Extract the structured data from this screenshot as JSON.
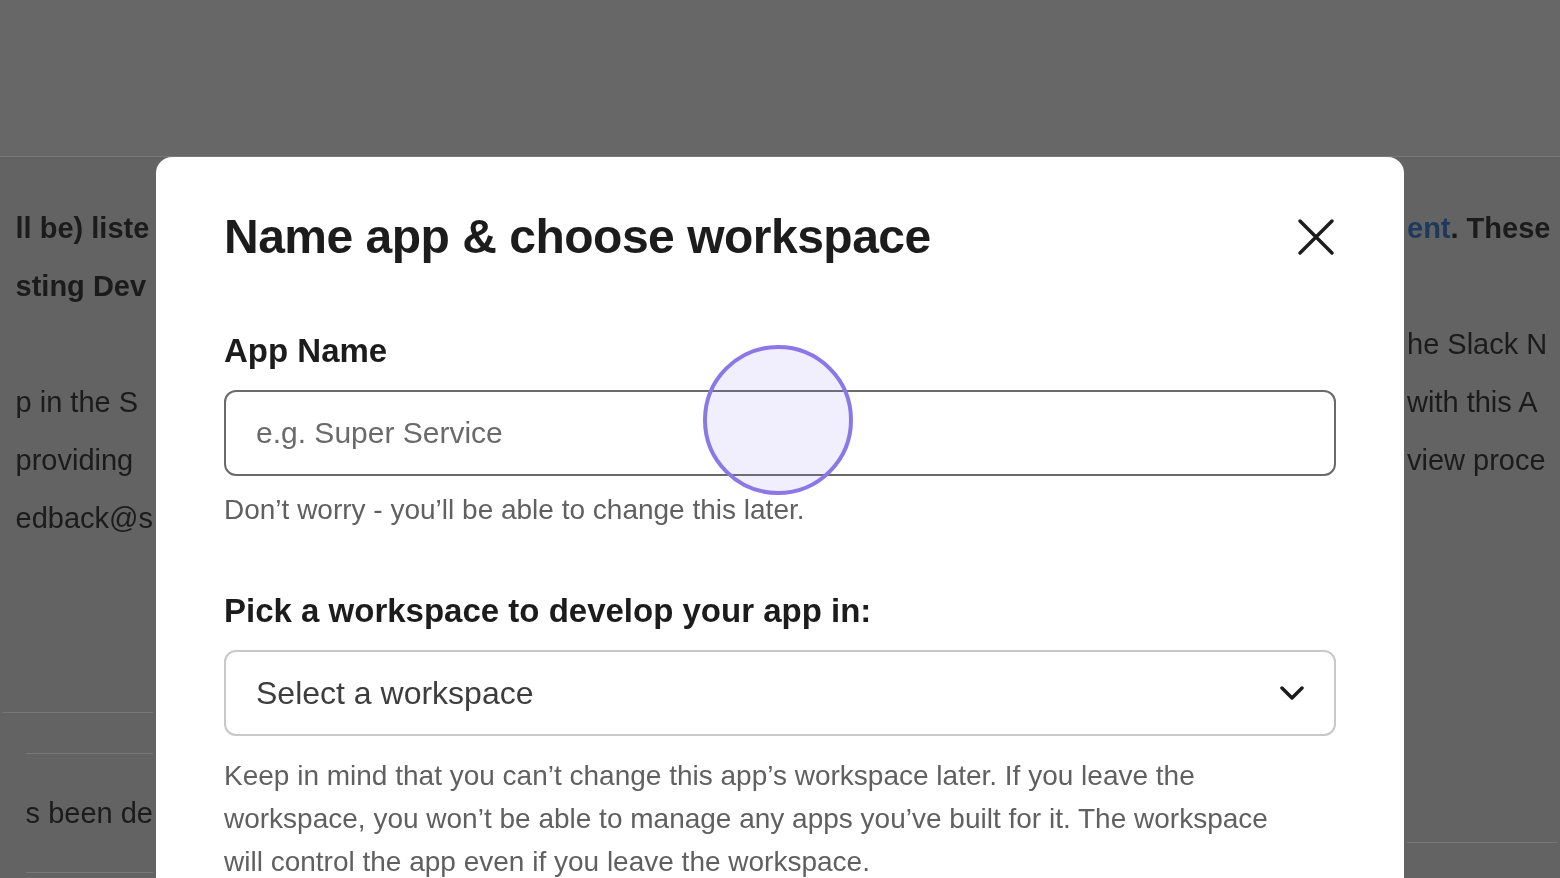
{
  "background_page": {
    "left_lines": [
      {
        "text": "ll be) liste",
        "bold": true
      },
      {
        "text": "sting Dev",
        "bold": true
      },
      {
        "text": "p in the S",
        "bold": false
      },
      {
        "text": "providing",
        "bold": false
      },
      {
        "text": "edback@s",
        "bold": false
      }
    ],
    "right_lines": [
      {
        "link": "ent",
        "text": ". These",
        "bold": true
      },
      {
        "text": "he Slack N",
        "bold": false
      },
      {
        "text": "with this A",
        "bold": false
      },
      {
        "text": "view proce",
        "bold": false
      }
    ],
    "left_row_text": "s been de"
  },
  "dialog": {
    "title": "Name app & choose workspace",
    "app_name": {
      "label": "App Name",
      "placeholder": "e.g. Super Service",
      "help": "Don’t worry - you’ll be able to change this later."
    },
    "workspace": {
      "label": "Pick a workspace to develop your app in:",
      "placeholder": "Select a workspace",
      "note": "Keep in mind that you can’t change this app’s workspace later. If you leave the workspace, you won’t be able to manage any apps you’ve built for it. The workspace will control the app even if you leave the workspace."
    }
  }
}
